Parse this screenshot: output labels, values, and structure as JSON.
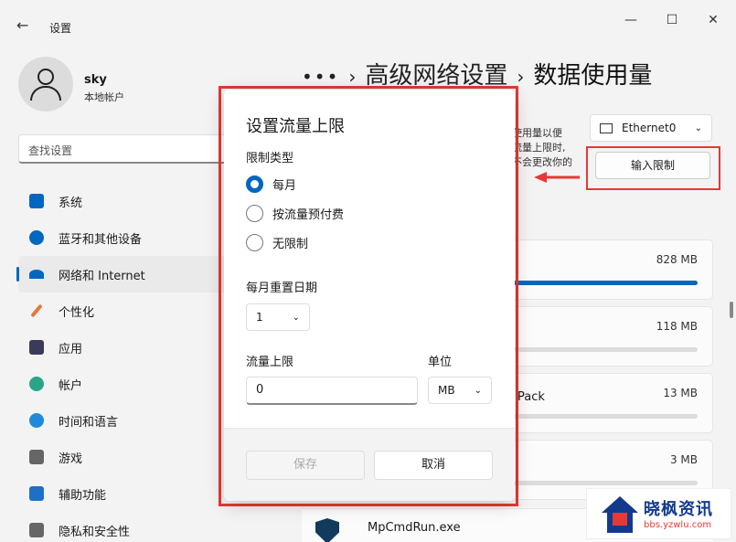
{
  "window": {
    "title": "设置",
    "back_icon": "←",
    "minimize_icon": "—",
    "maximize_icon": "☐",
    "close_icon": "✕"
  },
  "profile": {
    "name": "sky",
    "account_type": "本地帐户"
  },
  "search": {
    "placeholder": "查找设置"
  },
  "sidebar": {
    "items": [
      {
        "label": "系统",
        "icon": "system-icon",
        "color": "#0067c0"
      },
      {
        "label": "蓝牙和其他设备",
        "icon": "bluetooth-icon",
        "color": "#0067c0"
      },
      {
        "label": "网络和 Internet",
        "icon": "wifi-icon",
        "color": "#0067c0",
        "active": true
      },
      {
        "label": "个性化",
        "icon": "brush-icon",
        "color": "#e07b39"
      },
      {
        "label": "应用",
        "icon": "apps-icon",
        "color": "#3a3a5a"
      },
      {
        "label": "帐户",
        "icon": "account-icon",
        "color": "#2aa58a"
      },
      {
        "label": "时间和语言",
        "icon": "clock-icon",
        "color": "#1f8ad9"
      },
      {
        "label": "游戏",
        "icon": "gamepad-icon",
        "color": "#666666"
      },
      {
        "label": "辅助功能",
        "icon": "accessibility-icon",
        "color": "#1f6fc9"
      },
      {
        "label": "隐私和安全性",
        "icon": "shield-icon",
        "color": "#666666"
      }
    ]
  },
  "breadcrumb": {
    "dots": "•••",
    "separator": "›",
    "parent": "高级网络设置",
    "current": "数据使用量"
  },
  "adapter": {
    "selected": "Ethernet0"
  },
  "description": {
    "lines": [
      "使用量以便",
      "流量上限时,",
      "不会更改你的"
    ]
  },
  "limit_button": {
    "label": "输入限制"
  },
  "apps": [
    {
      "label": "",
      "size": "828 MB",
      "fraction": 1.0
    },
    {
      "label": "",
      "size": "118 MB",
      "fraction": 0.0
    },
    {
      "label": "Pack",
      "size": "13 MB",
      "fraction": 0.0
    },
    {
      "label": "",
      "size": "3 MB",
      "fraction": 0.0
    }
  ],
  "bottom_app": {
    "label": "MpCmdRun.exe"
  },
  "dialog": {
    "title": "设置流量上限",
    "limit_type_label": "限制类型",
    "options": [
      {
        "label": "每月",
        "checked": true
      },
      {
        "label": "按流量预付费",
        "checked": false
      },
      {
        "label": "无限制",
        "checked": false
      }
    ],
    "reset_label": "每月重置日期",
    "reset_value": "1",
    "limit_label": "流量上限",
    "limit_value": "0",
    "unit_label": "单位",
    "unit_value": "MB",
    "save_label": "保存",
    "cancel_label": "取消"
  },
  "watermark": {
    "title": "晓枫资讯",
    "url": "bbs.yzwlu.com"
  },
  "colors": {
    "accent": "#0067c0",
    "highlight_red": "#e53935"
  }
}
